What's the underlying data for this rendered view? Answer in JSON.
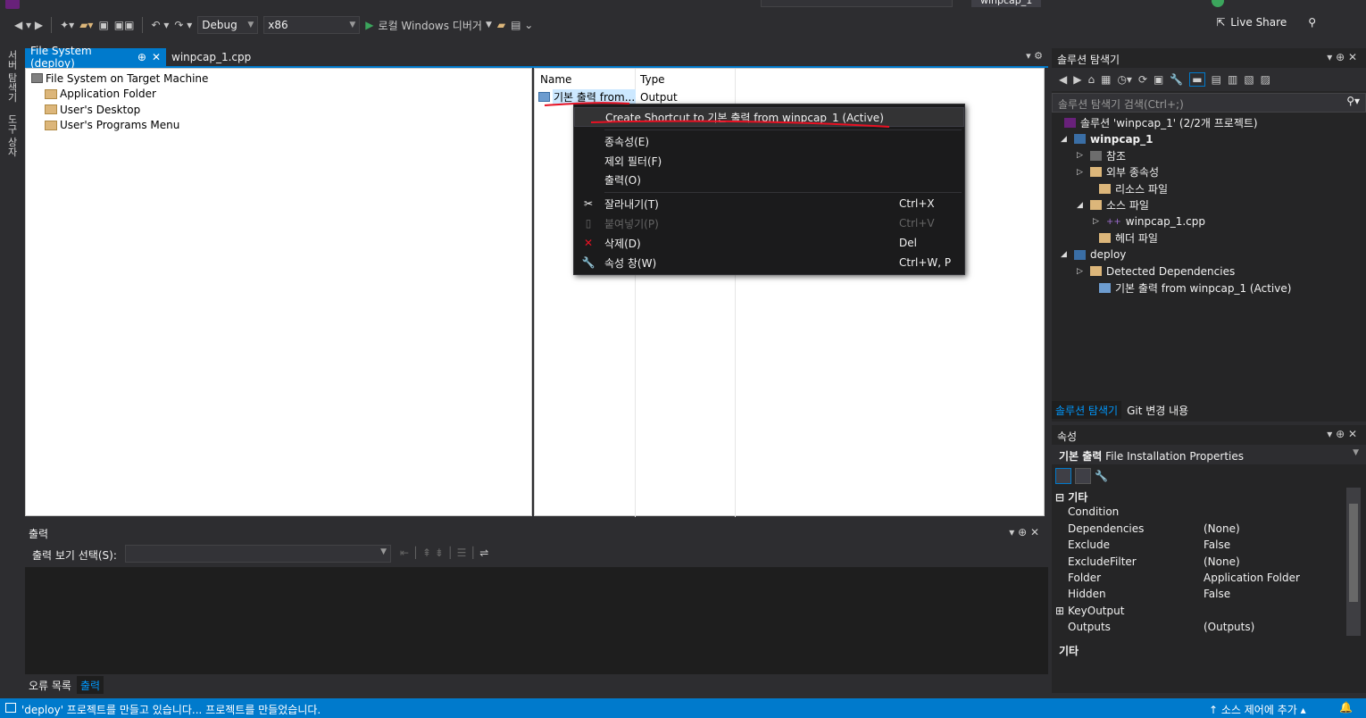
{
  "toolbar": {
    "config": "Debug",
    "platform": "x86",
    "debugger": "로컬 Windows 디버거",
    "live_share": "Live Share"
  },
  "left_tabs": [
    "서버 탐색기",
    "도구 상자"
  ],
  "doc_tabs": [
    {
      "label": "File System (deploy)",
      "active": true,
      "pin": "⊕",
      "close": "✕"
    },
    {
      "label": "winpcap_1.cpp",
      "active": false
    }
  ],
  "fs_tree": {
    "root": "File System on Target Machine",
    "folders": [
      "Application Folder",
      "User's Desktop",
      "User's Programs Menu"
    ]
  },
  "fs_list": {
    "columns": [
      "Name",
      "Type"
    ],
    "rows": [
      {
        "name": "기본 출력 from...",
        "type": "Output"
      }
    ]
  },
  "context_menu": {
    "items": [
      {
        "label": "Create Shortcut to 기본 출력 from winpcap_1 (Active)",
        "shortcut": ""
      },
      {
        "label": "종속성(E)",
        "shortcut": ""
      },
      {
        "label": "제외 필터(F)",
        "shortcut": ""
      },
      {
        "label": "출력(O)",
        "shortcut": ""
      },
      {
        "label": "잘라내기(T)",
        "shortcut": "Ctrl+X",
        "icon": "cut-icon"
      },
      {
        "label": "붙여넣기(P)",
        "shortcut": "Ctrl+V",
        "disabled": true,
        "icon": "paste-icon"
      },
      {
        "label": "삭제(D)",
        "shortcut": "Del",
        "icon": "delete-icon"
      },
      {
        "label": "속성 창(W)",
        "shortcut": "Ctrl+W, P",
        "icon": "wrench-icon"
      }
    ]
  },
  "output_pane": {
    "title": "출력",
    "select_label": "출력 보기 선택(S):",
    "tabs": [
      "오류 목록",
      "출력"
    ]
  },
  "solution_explorer": {
    "title": "솔루션 탐색기",
    "search_placeholder": "솔루션 탐색기 검색(Ctrl+;)",
    "nodes": [
      {
        "label": "솔루션 'winpcap_1' (2/2개 프로젝트)",
        "level": 0,
        "exp": ""
      },
      {
        "label": "winpcap_1",
        "level": 0,
        "exp": "◢",
        "bold": true
      },
      {
        "label": "참조",
        "level": 1,
        "exp": "▷"
      },
      {
        "label": "외부 종속성",
        "level": 1,
        "exp": "▷"
      },
      {
        "label": "리소스 파일",
        "level": 1,
        "exp": ""
      },
      {
        "label": "소스 파일",
        "level": 1,
        "exp": "◢"
      },
      {
        "label": "winpcap_1.cpp",
        "level": 2,
        "exp": "▷"
      },
      {
        "label": "헤더 파일",
        "level": 1,
        "exp": ""
      },
      {
        "label": "deploy",
        "level": 0,
        "exp": "◢"
      },
      {
        "label": "Detected Dependencies",
        "level": 1,
        "exp": "▷"
      },
      {
        "label": "기본 출력 from winpcap_1 (Active)",
        "level": 1,
        "exp": ""
      }
    ],
    "bottom_tabs": [
      "솔루션 탐색기",
      "Git 변경 내용"
    ]
  },
  "properties": {
    "title": "속성",
    "object_bold": "기본 출력",
    "object_type": "File Installation Properties",
    "category": "기타",
    "rows": [
      {
        "k": "Condition",
        "v": ""
      },
      {
        "k": "Dependencies",
        "v": "(None)"
      },
      {
        "k": "Exclude",
        "v": "False"
      },
      {
        "k": "ExcludeFilter",
        "v": "(None)"
      },
      {
        "k": "Folder",
        "v": "Application Folder"
      },
      {
        "k": "Hidden",
        "v": "False"
      },
      {
        "k": "KeyOutput",
        "v": "",
        "expandable": true
      },
      {
        "k": "Outputs",
        "v": "(Outputs)"
      }
    ],
    "desc_title": "기타"
  },
  "status": {
    "message": "'deploy' 프로젝트를 만들고 있습니다... 프로젝트를 만들었습니다.",
    "source_control": "↑ 소스 제어에 추가 ▴"
  },
  "colors": {
    "accent": "#007acc",
    "annotation": "#e81123"
  }
}
